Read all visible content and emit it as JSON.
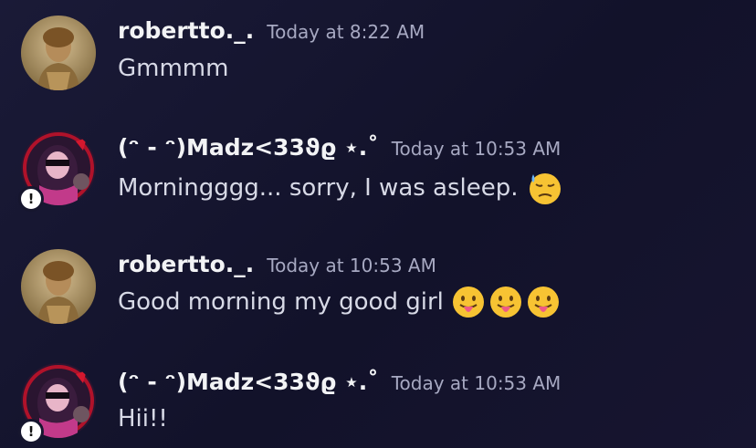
{
  "messages": [
    {
      "username": "robertto._.",
      "timestamp": "Today at 8:22 AM",
      "text": "Gmmmm",
      "avatar": "statue-avatar",
      "emojis": []
    },
    {
      "username": "(ᵔ - ᵔ)Madz<33ϑϱ ⋆.˚",
      "timestamp": "Today at 10:53 AM",
      "text": "Morningggg... sorry, I was asleep.",
      "avatar": "anime-avatar",
      "status_badge": "!",
      "emojis": [
        "downcast-sweat-emoji"
      ]
    },
    {
      "username": "robertto._.",
      "timestamp": "Today at 10:53 AM",
      "text": "Good morning my good girl",
      "avatar": "statue-avatar",
      "emojis": [
        "tongue-out-emoji",
        "tongue-out-emoji",
        "tongue-out-emoji"
      ]
    },
    {
      "username": "(ᵔ - ᵔ)Madz<33ϑϱ ⋆.˚",
      "timestamp": "Today at 10:53 AM",
      "text": "Hii!!",
      "avatar": "anime-avatar",
      "status_badge": "!",
      "emojis": []
    }
  ],
  "colors": {
    "background": "#16162e",
    "username": "#f2f3f5",
    "timestamp": "#a7a9c2",
    "message_text": "#d7d9e6"
  }
}
